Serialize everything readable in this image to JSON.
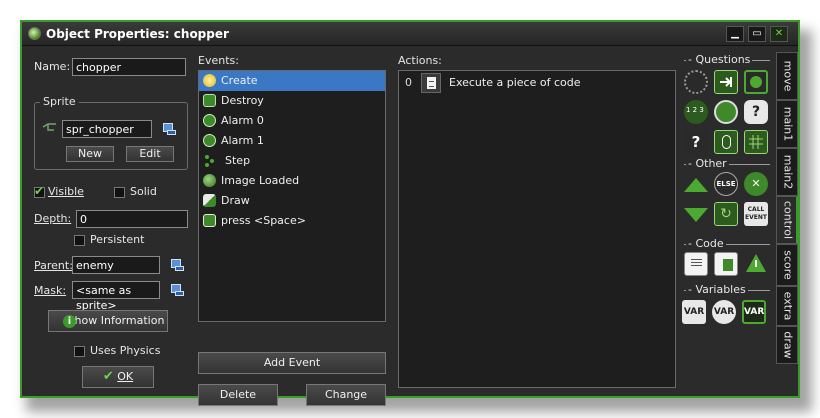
{
  "window": {
    "title": "Object Properties: chopper"
  },
  "left": {
    "name_label": "Name:",
    "name_value": "chopper",
    "sprite_group": "Sprite",
    "sprite_value": "spr_chopper",
    "new_label": "New",
    "edit_label": "Edit",
    "visible_label": "Visible",
    "solid_label": "Solid",
    "depth_label": "Depth:",
    "depth_value": "0",
    "persistent_label": "Persistent",
    "parent_label": "Parent:",
    "parent_value": "enemy",
    "mask_label": "Mask:",
    "mask_value": "<same as sprite>",
    "show_info_label": "Show Information",
    "physics_label": "Uses Physics",
    "ok_label": "OK"
  },
  "events": {
    "title": "Events:",
    "items": [
      "Create",
      "Destroy",
      "Alarm 0",
      "Alarm 1",
      "Step",
      "Image Loaded",
      "Draw",
      "press <Space>"
    ],
    "add_label": "Add Event",
    "delete_label": "Delete",
    "change_label": "Change"
  },
  "actions": {
    "title": "Actions:",
    "items": [
      {
        "num": "0",
        "text": "Execute a piece of code"
      }
    ]
  },
  "library": {
    "questions_title": "Questions",
    "other_title": "Other",
    "code_title": "Code",
    "variables_title": "Variables",
    "else_label": "ELSE",
    "call_label_1": "CALL",
    "call_label_2": "EVENT",
    "var_label": "VAR",
    "one_two_three": "1 2 3",
    "question_mark": "?"
  },
  "tabs": [
    "move",
    "main1",
    "main2",
    "control",
    "score",
    "extra",
    "draw"
  ],
  "colors": {
    "accent": "#3a9a2a",
    "selected": "#3a78c6",
    "background": "#2b2b2b"
  }
}
